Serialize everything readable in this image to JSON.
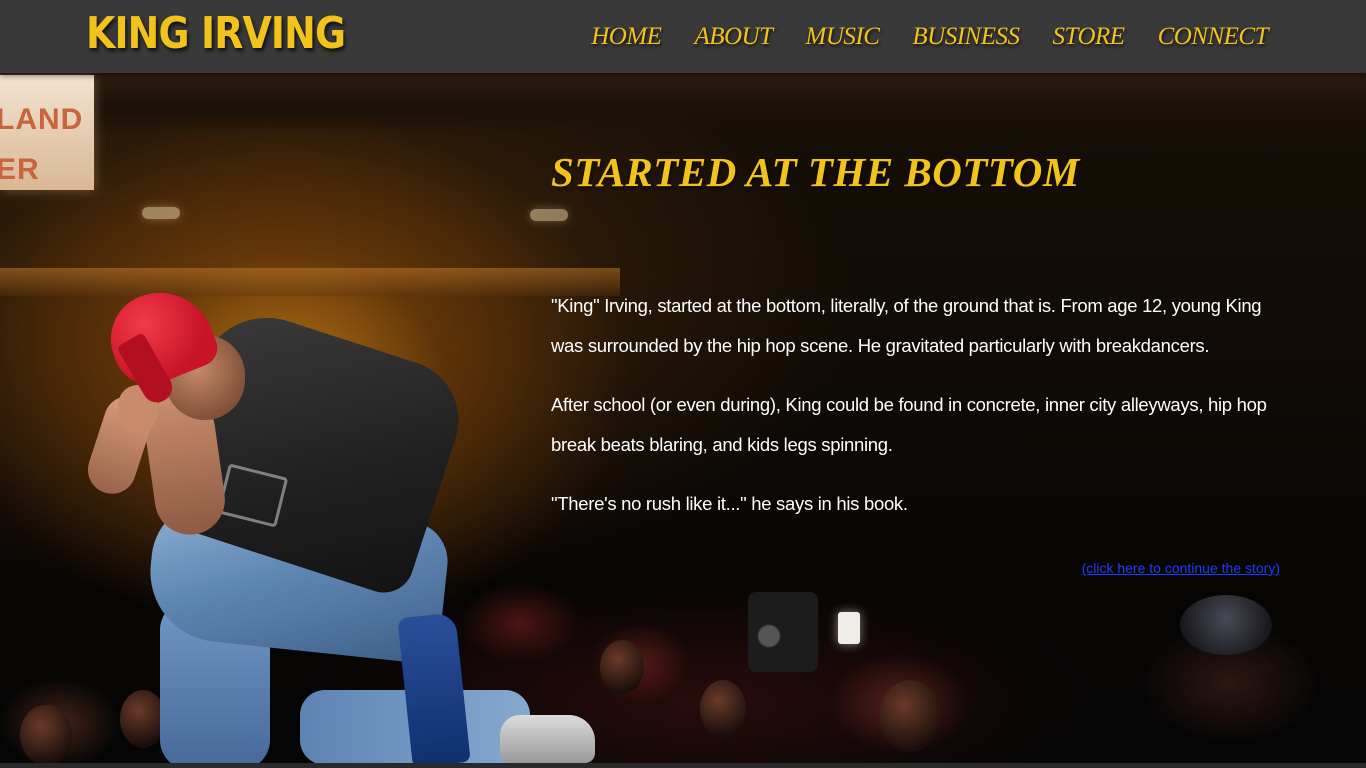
{
  "header": {
    "brand": "KING IRVING",
    "nav": [
      {
        "label": "HOME"
      },
      {
        "label": "ABOUT"
      },
      {
        "label": "MUSIC"
      },
      {
        "label": "BUSINESS"
      },
      {
        "label": "STORE"
      },
      {
        "label": "CONNECT"
      }
    ]
  },
  "background": {
    "sign_lines": [
      "LAND",
      "ER"
    ]
  },
  "story": {
    "title": "STARTED AT THE BOTTOM",
    "paragraphs": [
      "\"King\" Irving, started at the bottom, literally, of the ground that is. From age 12, young King was surrounded by the hip hop scene. He gravitated particularly with breakdancers.",
      "After school (or even during), King could be found in concrete, inner city alleyways, hip hop break beats blaring, and kids legs spinning.",
      "\"There's no rush like it...\" he says in his book."
    ],
    "continue_link": "(click here to continue the story)"
  },
  "colors": {
    "accent": "#f2c31a",
    "header_bg": "#393939",
    "link": "#1f3cff"
  }
}
